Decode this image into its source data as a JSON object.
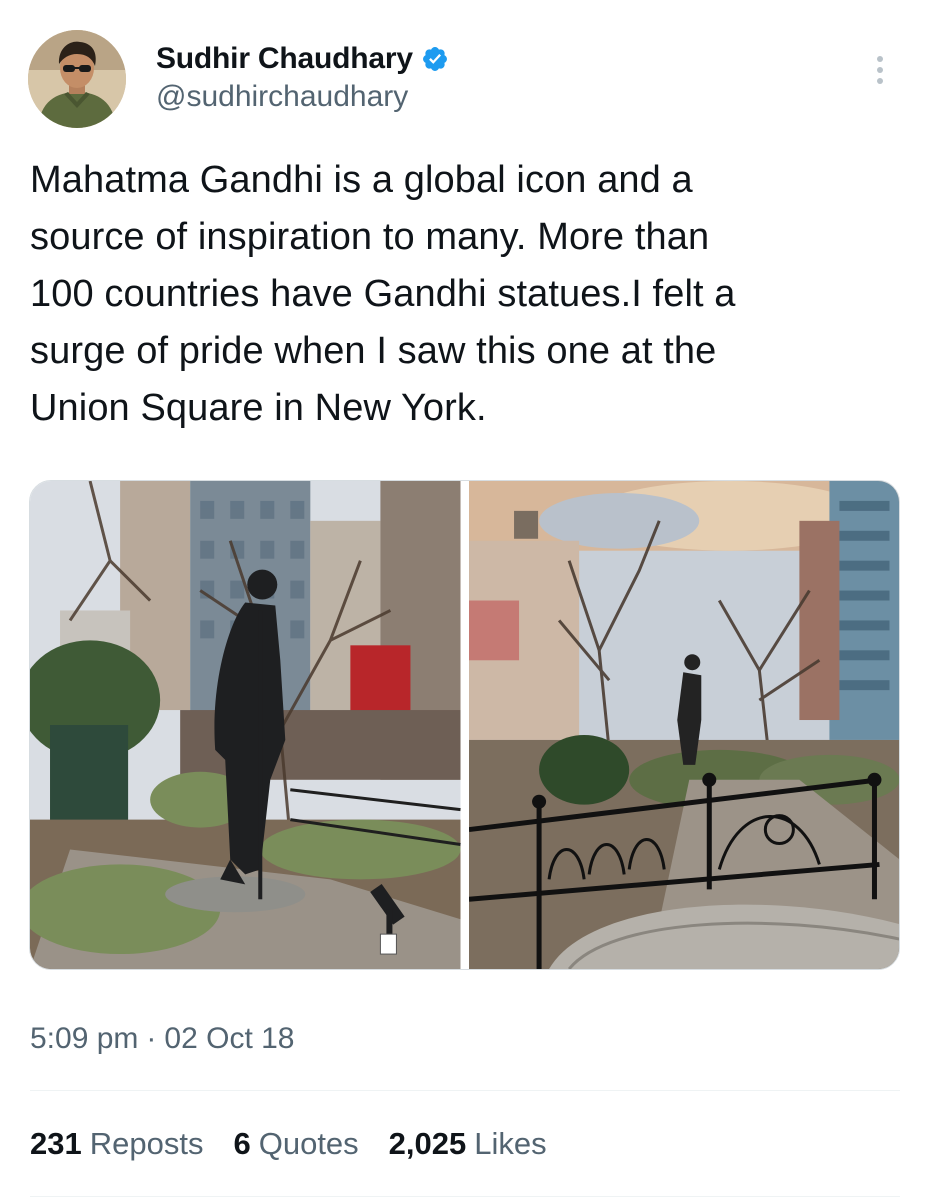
{
  "author": {
    "display_name": "Sudhir Chaudhary",
    "handle": "@sudhirchaudhary",
    "verified": true,
    "verified_color": "#1d9bf0"
  },
  "tweet": {
    "text": "Mahatma Gandhi is a global icon and a\nsource of inspiration to many. More than\n100 countries have Gandhi statues.I felt a\nsurge of pride when I saw this one at the\nUnion Square in New York.",
    "time": "5:09 pm",
    "separator": "·",
    "date": "02 Oct 18"
  },
  "media": [
    {
      "description_icon": "gandhi-statue-photo"
    },
    {
      "description_icon": "union-square-park-photo"
    }
  ],
  "stats": {
    "reposts_count": "231",
    "reposts_label": "Reposts",
    "quotes_count": "6",
    "quotes_label": "Quotes",
    "likes_count": "2,025",
    "likes_label": "Likes"
  },
  "colors": {
    "text_primary": "#0f1419",
    "text_secondary": "#536471",
    "divider": "#eff3f4"
  }
}
